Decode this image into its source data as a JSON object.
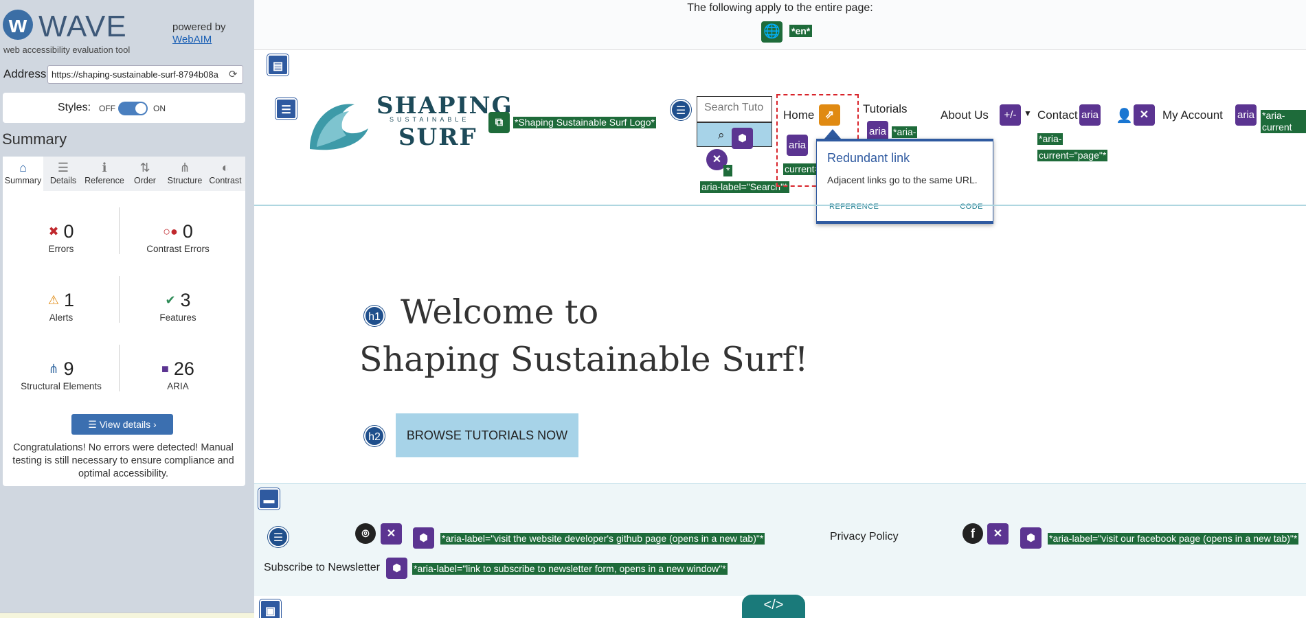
{
  "sidebar": {
    "logo_letter": "w",
    "title": "WAVE",
    "subtitle": "web accessibility evaluation tool",
    "powered_by": "powered by",
    "webaim_link": "WebAIM",
    "address_label": "Address:",
    "address_value": "https://shaping-sustainable-surf-8794b08a",
    "styles_label": "Styles:",
    "styles_off": "OFF",
    "styles_on": "ON",
    "styles_enabled": true,
    "summary_heading": "Summary",
    "tabs": [
      {
        "label": "Summary",
        "icon": "home-icon",
        "glyph": "⌂",
        "active": true
      },
      {
        "label": "Details",
        "icon": "list-icon",
        "glyph": "☰",
        "active": false
      },
      {
        "label": "Reference",
        "icon": "info-icon",
        "glyph": "ℹ",
        "active": false
      },
      {
        "label": "Order",
        "icon": "order-icon",
        "glyph": "⇅",
        "active": false
      },
      {
        "label": "Structure",
        "icon": "structure-icon",
        "glyph": "⋔",
        "active": false
      },
      {
        "label": "Contrast",
        "icon": "contrast-icon",
        "glyph": "◐",
        "active": false
      }
    ],
    "stats": {
      "errors": {
        "value": "0",
        "label": "Errors",
        "icon": "error-icon",
        "color": "#c0282d"
      },
      "contrast_errors": {
        "value": "0",
        "label": "Contrast Errors",
        "icon": "contrast-error-icon",
        "color": "#c0282d"
      },
      "alerts": {
        "value": "1",
        "label": "Alerts",
        "icon": "alert-icon",
        "color": "#e08a12"
      },
      "features": {
        "value": "3",
        "label": "Features",
        "icon": "feature-icon",
        "color": "#2e8b57"
      },
      "structural": {
        "value": "9",
        "label": "Structural Elements",
        "icon": "structure-icon",
        "color": "#3b6ea5"
      },
      "aria": {
        "value": "26",
        "label": "ARIA",
        "icon": "aria-icon",
        "color": "#5b3491"
      }
    },
    "view_details": "View details ›",
    "congrats": "Congratulations! No errors were detected! Manual testing is still necessary to ensure compliance and optimal accessibility."
  },
  "page": {
    "apply_text": "The following apply to the entire page:",
    "lang_label": "*en*",
    "logo_alt_label": "*Shaping Sustainable Surf Logo*",
    "brand_line1": "SHAPING",
    "brand_line2": "SUSTAINABLE",
    "brand_line3": "SURF",
    "search_placeholder": "Search Tuto",
    "search_aria": "aria-label=\"Search\"*",
    "nav": {
      "home": "Home",
      "tutorials": "Tutorials",
      "about": "About Us",
      "contact": "Contact",
      "account": "My Account"
    },
    "aria_badge": "aria",
    "aria_plusminus": "+/-",
    "aria_current_page": "*aria-current=\"page\"*",
    "aria_current_short": "*aria-",
    "aria_current_right": "*aria-current",
    "current_fragment": "current=",
    "popup": {
      "title": "Redundant link",
      "description": "Adjacent links go to the same URL.",
      "reference": "REFERENCE",
      "code": "CODE"
    },
    "h1_badge": "h1",
    "h2_badge": "h2",
    "welcome_line1": "Welcome to",
    "welcome_line2": "Shaping Sustainable Surf!",
    "browse_button": "BROWSE TUTORIALS NOW",
    "footer": {
      "github_label": "*aria-label=\"visit the website developer's github page (opens in a new tab)\"*",
      "privacy": "Privacy Policy",
      "facebook_label": "*aria-label=\"visit our facebook page (opens in a new tab)\"*",
      "subscribe": "Subscribe to Newsletter",
      "subscribe_label": "*aria-label=\"link to subscribe to newsletter form, opens in a new window\"*"
    },
    "code_tab": "</>"
  }
}
